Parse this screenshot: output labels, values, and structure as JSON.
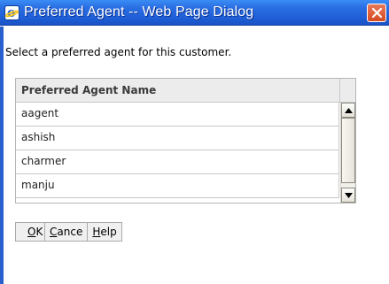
{
  "window": {
    "title": "Preferred Agent -- Web Page Dialog",
    "icon": "ie-icon",
    "close": "close-icon"
  },
  "instruction": "Select a preferred agent for this customer.",
  "grid": {
    "columns": [
      "Preferred Agent Name"
    ],
    "rows": [
      "aagent",
      "ashish",
      "charmer",
      "manju"
    ]
  },
  "buttons": {
    "ok": {
      "mnemonic": "O",
      "rest": "K"
    },
    "cancel": {
      "mnemonic": "C",
      "rest": "ance"
    },
    "help": {
      "mnemonic": "H",
      "rest": "elp"
    }
  },
  "colors": {
    "titlebar": "#2a6fe3",
    "close": "#d54a21"
  }
}
